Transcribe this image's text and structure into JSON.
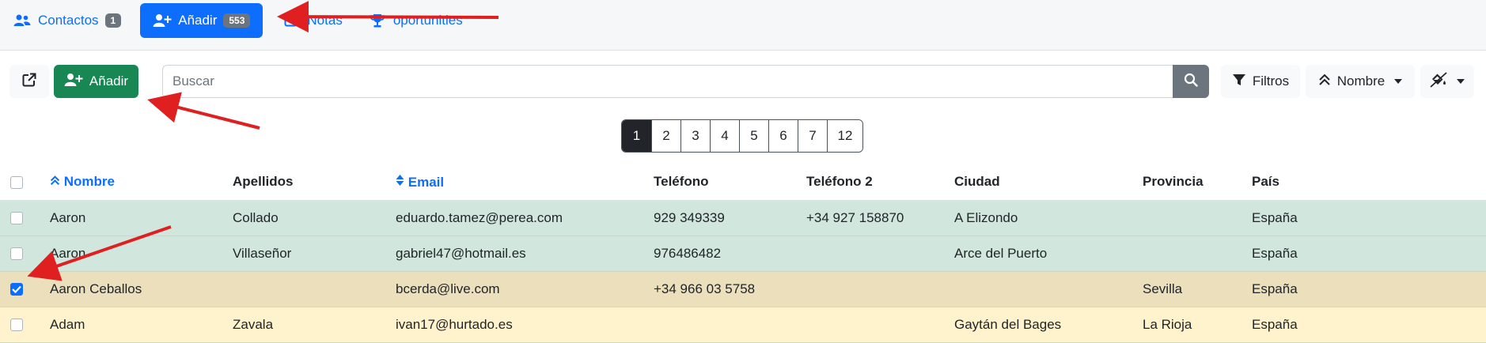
{
  "nav": {
    "tabs": [
      {
        "label": "Contactos",
        "badge": "1",
        "icon": "users-icon"
      },
      {
        "label": "Añadir",
        "badge": "553",
        "icon": "user-plus-icon"
      },
      {
        "label": "Notas",
        "icon": "note-icon"
      },
      {
        "label": "oportunities",
        "icon": "trophy-icon"
      }
    ]
  },
  "toolbar": {
    "add_label": "Añadir",
    "search_placeholder": "Buscar",
    "filters_label": "Filtros",
    "sort_label": "Nombre"
  },
  "pagination": {
    "pages": [
      "1",
      "2",
      "3",
      "4",
      "5",
      "6",
      "7",
      "12"
    ],
    "current": "1"
  },
  "table": {
    "headers": [
      "Nombre",
      "Apellidos",
      "Email",
      "Teléfono",
      "Teléfono 2",
      "Ciudad",
      "Provincia",
      "País"
    ],
    "rows": [
      {
        "nombre": "Aaron",
        "apellidos": "Collado",
        "email": "eduardo.tamez@perea.com",
        "telefono": "929 349339",
        "telefono2": "+34 927 158870",
        "ciudad": "A Elizondo",
        "provincia": "",
        "pais": "España"
      },
      {
        "nombre": "Aaron",
        "apellidos": "Villaseñor",
        "email": "gabriel47@hotmail.es",
        "telefono": "976486482",
        "telefono2": "",
        "ciudad": "Arce del Puerto",
        "provincia": "",
        "pais": "España"
      },
      {
        "nombre": "Aaron Ceballos",
        "apellidos": "",
        "email": "bcerda@live.com",
        "telefono": "+34 966 03 5758",
        "telefono2": "",
        "ciudad": "",
        "provincia": "Sevilla",
        "pais": "España"
      },
      {
        "nombre": "Adam",
        "apellidos": "Zavala",
        "email": "ivan17@hurtado.es",
        "telefono": "",
        "telefono2": "",
        "ciudad": "Gaytán del Bages",
        "provincia": "La Rioja",
        "pais": "España"
      }
    ]
  },
  "colors": {
    "primary": "#0d6efd",
    "success": "#198754",
    "annotation": "#e02020"
  }
}
